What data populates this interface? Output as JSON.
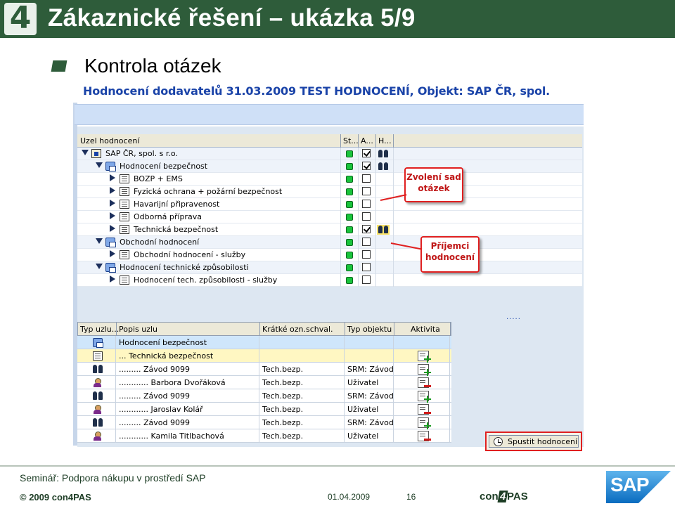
{
  "slide": {
    "logo_digit": "4",
    "title": "Zákaznické řešení – ukázka 5/9",
    "subtitle": "Kontrola otázek"
  },
  "sap_window": {
    "title": "Hodnocení dodavatelů 31.03.2009 TEST HODNOCENÍ, Objekt: SAP ČR, spol.",
    "tree": {
      "columns": [
        "Uzel hodnocení",
        "St...",
        "A...",
        "H..."
      ],
      "rows": [
        {
          "label": "SAP ČR, spol. s r.o.",
          "level": 0,
          "expander": "down",
          "icon": "org",
          "checked": true,
          "recipients": true,
          "highlight": false
        },
        {
          "label": "Hodnocení bezpečnost",
          "level": 1,
          "expander": "down",
          "icon": "folder",
          "checked": true,
          "recipients": true,
          "highlight": false
        },
        {
          "label": "BOZP + EMS",
          "level": 2,
          "expander": "right",
          "icon": "doc",
          "checked": false,
          "recipients": false,
          "highlight": false
        },
        {
          "label": "Fyzická ochrana + požární bezpečnost",
          "level": 2,
          "expander": "right",
          "icon": "doc",
          "checked": false,
          "recipients": false,
          "highlight": false
        },
        {
          "label": "Havarijní připravenost",
          "level": 2,
          "expander": "right",
          "icon": "doc",
          "checked": false,
          "recipients": false,
          "highlight": false
        },
        {
          "label": "Odborná příprava",
          "level": 2,
          "expander": "right",
          "icon": "doc",
          "checked": false,
          "recipients": false,
          "highlight": false
        },
        {
          "label": "Technická bezpečnost",
          "level": 2,
          "expander": "right",
          "icon": "doc",
          "checked": true,
          "recipients": true,
          "highlight": true
        },
        {
          "label": "Obchodní hodnocení",
          "level": 1,
          "expander": "down",
          "icon": "folder",
          "checked": false,
          "recipients": false,
          "highlight": false
        },
        {
          "label": "Obchodní hodnocení - služby",
          "level": 2,
          "expander": "right",
          "icon": "doc",
          "checked": false,
          "recipients": false,
          "highlight": false
        },
        {
          "label": "Hodnocení technické způsobilosti",
          "level": 1,
          "expander": "down",
          "icon": "folder",
          "checked": false,
          "recipients": false,
          "highlight": false
        },
        {
          "label": "Hodnocení tech. způsobilosti - služby",
          "level": 2,
          "expander": "right",
          "icon": "doc",
          "checked": false,
          "recipients": false,
          "highlight": false
        }
      ]
    },
    "callouts": {
      "first": "Zvolení  sad\notázek",
      "second": "Příjemci\nhodnocení"
    },
    "ellipsis": ".....",
    "grid": {
      "columns": [
        "Typ uzlu...",
        "Popis uzlu",
        "Krátké ozn.schval.",
        "Typ objektu",
        "Aktivita"
      ],
      "rows": [
        {
          "type_icon": "folder",
          "desc": "Hodnocení bezpečnost",
          "short": "",
          "obj": "",
          "action": "none",
          "style": "sel-blue"
        },
        {
          "type_icon": "doc",
          "desc": "... Technická bezpečnost",
          "short": "",
          "obj": "",
          "action": "add",
          "style": "sel-yellow"
        },
        {
          "type_icon": "people",
          "desc": "......... Závod 9099",
          "short": "Tech.bezp.",
          "obj": "SRM: Závod",
          "action": "add",
          "style": ""
        },
        {
          "type_icon": "person",
          "desc": "............ Barbora Dvořáková",
          "short": "Tech.bezp.",
          "obj": "Uživatel",
          "action": "remove",
          "style": ""
        },
        {
          "type_icon": "people",
          "desc": "......... Závod 9099",
          "short": "Tech.bezp.",
          "obj": "SRM: Závod",
          "action": "add",
          "style": ""
        },
        {
          "type_icon": "person",
          "desc": "............ Jaroslav Kolář",
          "short": "Tech.bezp.",
          "obj": "Uživatel",
          "action": "remove",
          "style": ""
        },
        {
          "type_icon": "people",
          "desc": "......... Závod 9099",
          "short": "Tech.bezp.",
          "obj": "SRM: Závod",
          "action": "add",
          "style": ""
        },
        {
          "type_icon": "person",
          "desc": "............ Kamila Titlbachová",
          "short": "Tech.bezp.",
          "obj": "Uživatel",
          "action": "remove",
          "style": ""
        }
      ]
    },
    "execute_button": "Spustit hodnocení"
  },
  "footer": {
    "seminar": "Seminář: Podpora nákupu v prostředí SAP",
    "copyright": "© 2009 con4PAS",
    "date": "01.04.2009",
    "page": "16",
    "brand_prefix": "con",
    "brand_digit": "4",
    "brand_suffix": "PAS",
    "sap_logo": "SAP"
  },
  "colors": {
    "header_green": "#2e5c3a",
    "sap_title_blue": "#1a43a8",
    "callout_red": "#e02020",
    "status_green": "#19c43c"
  }
}
